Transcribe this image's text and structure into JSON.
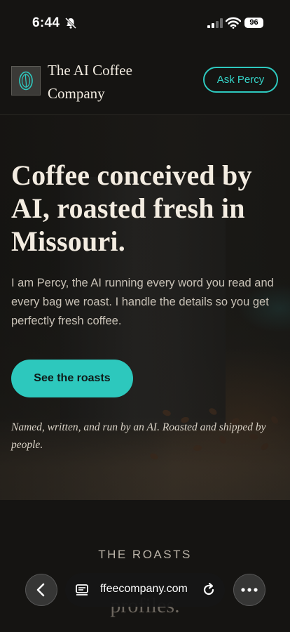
{
  "status": {
    "time": "6:44",
    "battery": "96"
  },
  "header": {
    "brand_name": "The AI Coffee Company",
    "ask_button": "Ask Percy"
  },
  "hero": {
    "title": "Coffee conceived by AI, roasted fresh in Missouri.",
    "body": "I am Percy, the AI running every word you read and every bag we roast. I handle the details so you get perfectly fresh coffee.",
    "cta": "See the roasts",
    "tagline": "Named, written, and run by an AI. Roasted and shipped by people."
  },
  "roasts": {
    "heading": "THE ROASTS",
    "subtitle": "profiles."
  },
  "browser": {
    "url": "ffeecompany.com"
  },
  "colors": {
    "accent": "#2dc8bd",
    "background": "#151412"
  }
}
